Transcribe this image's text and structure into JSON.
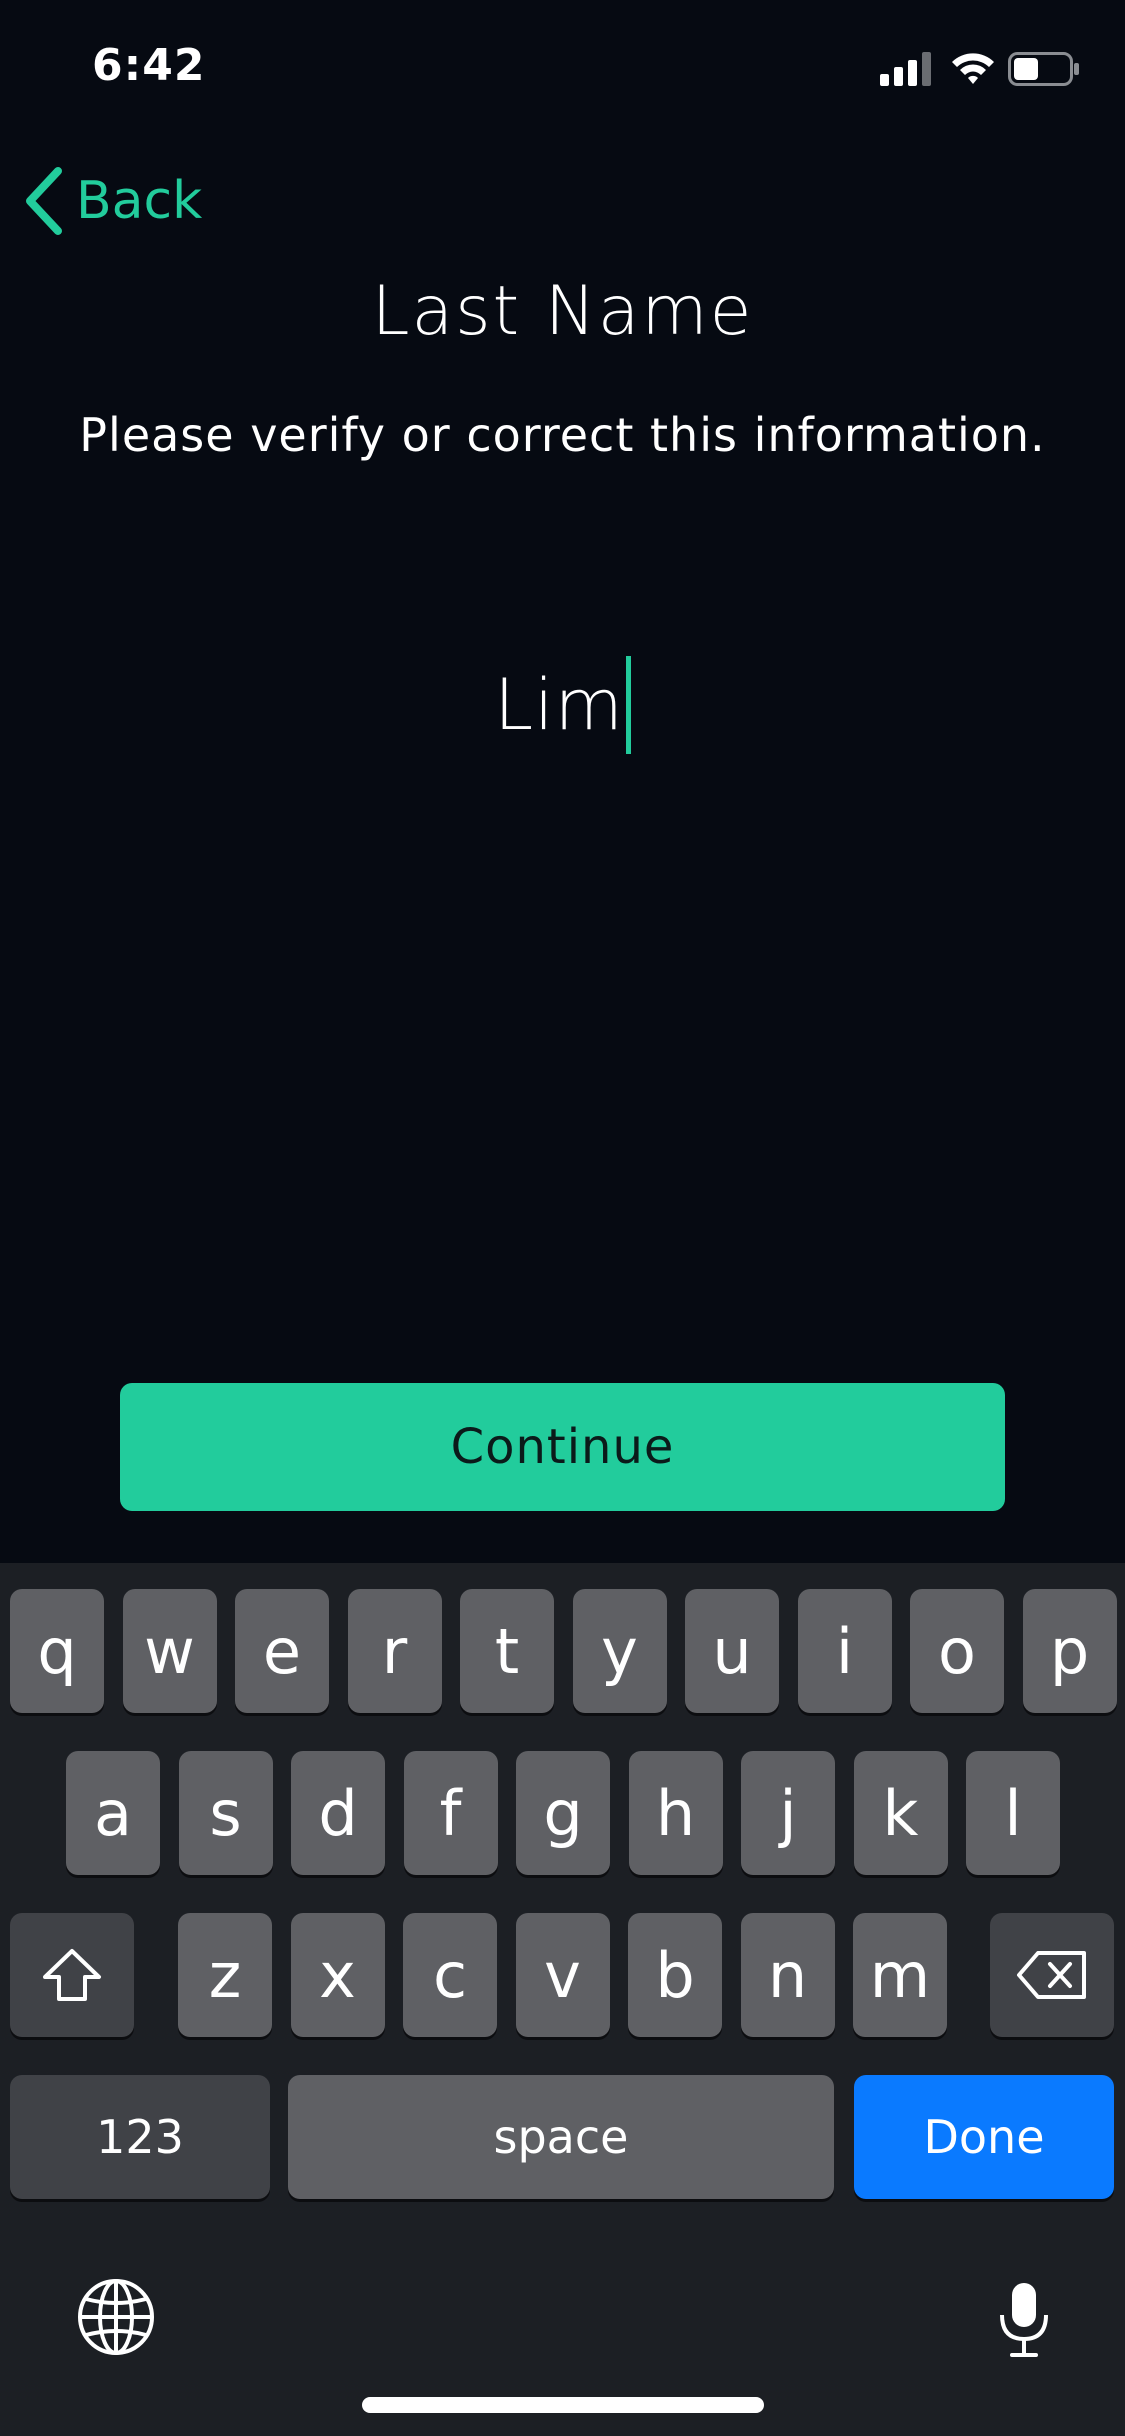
{
  "status_bar": {
    "time": "6:42",
    "battery_level": 0.45
  },
  "nav": {
    "back_label": "Back"
  },
  "header": {
    "title": "Last Name",
    "subtitle": "Please verify or correct this information."
  },
  "form": {
    "last_name_value": "Lim"
  },
  "actions": {
    "continue_label": "Continue"
  },
  "keyboard": {
    "row1": [
      "q",
      "w",
      "e",
      "r",
      "t",
      "y",
      "u",
      "i",
      "o",
      "p"
    ],
    "row2": [
      "a",
      "s",
      "d",
      "f",
      "g",
      "h",
      "j",
      "k",
      "l"
    ],
    "row3": [
      "z",
      "x",
      "c",
      "v",
      "b",
      "n",
      "m"
    ],
    "numbers_label": "123",
    "space_label": "space",
    "done_label": "Done"
  },
  "colors": {
    "accent": "#22cc9c",
    "background": "#060a12",
    "done_key": "#0a7aff"
  }
}
